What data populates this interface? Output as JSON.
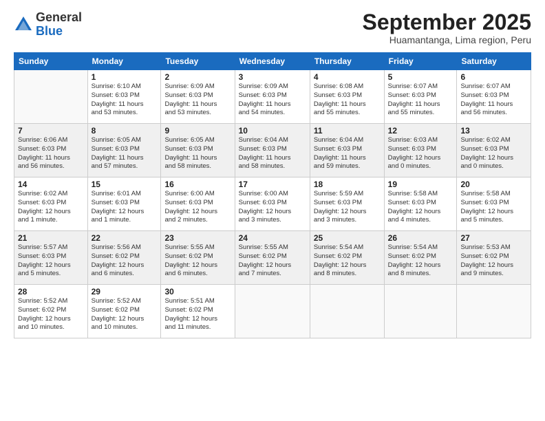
{
  "logo": {
    "general": "General",
    "blue": "Blue"
  },
  "title": "September 2025",
  "subtitle": "Huamantanga, Lima region, Peru",
  "days_of_week": [
    "Sunday",
    "Monday",
    "Tuesday",
    "Wednesday",
    "Thursday",
    "Friday",
    "Saturday"
  ],
  "weeks": [
    [
      {
        "day": "",
        "info": ""
      },
      {
        "day": "1",
        "info": "Sunrise: 6:10 AM\nSunset: 6:03 PM\nDaylight: 11 hours\nand 53 minutes."
      },
      {
        "day": "2",
        "info": "Sunrise: 6:09 AM\nSunset: 6:03 PM\nDaylight: 11 hours\nand 53 minutes."
      },
      {
        "day": "3",
        "info": "Sunrise: 6:09 AM\nSunset: 6:03 PM\nDaylight: 11 hours\nand 54 minutes."
      },
      {
        "day": "4",
        "info": "Sunrise: 6:08 AM\nSunset: 6:03 PM\nDaylight: 11 hours\nand 55 minutes."
      },
      {
        "day": "5",
        "info": "Sunrise: 6:07 AM\nSunset: 6:03 PM\nDaylight: 11 hours\nand 55 minutes."
      },
      {
        "day": "6",
        "info": "Sunrise: 6:07 AM\nSunset: 6:03 PM\nDaylight: 11 hours\nand 56 minutes."
      }
    ],
    [
      {
        "day": "7",
        "info": "Sunrise: 6:06 AM\nSunset: 6:03 PM\nDaylight: 11 hours\nand 56 minutes."
      },
      {
        "day": "8",
        "info": "Sunrise: 6:05 AM\nSunset: 6:03 PM\nDaylight: 11 hours\nand 57 minutes."
      },
      {
        "day": "9",
        "info": "Sunrise: 6:05 AM\nSunset: 6:03 PM\nDaylight: 11 hours\nand 58 minutes."
      },
      {
        "day": "10",
        "info": "Sunrise: 6:04 AM\nSunset: 6:03 PM\nDaylight: 11 hours\nand 58 minutes."
      },
      {
        "day": "11",
        "info": "Sunrise: 6:04 AM\nSunset: 6:03 PM\nDaylight: 11 hours\nand 59 minutes."
      },
      {
        "day": "12",
        "info": "Sunrise: 6:03 AM\nSunset: 6:03 PM\nDaylight: 12 hours\nand 0 minutes."
      },
      {
        "day": "13",
        "info": "Sunrise: 6:02 AM\nSunset: 6:03 PM\nDaylight: 12 hours\nand 0 minutes."
      }
    ],
    [
      {
        "day": "14",
        "info": "Sunrise: 6:02 AM\nSunset: 6:03 PM\nDaylight: 12 hours\nand 1 minute."
      },
      {
        "day": "15",
        "info": "Sunrise: 6:01 AM\nSunset: 6:03 PM\nDaylight: 12 hours\nand 1 minute."
      },
      {
        "day": "16",
        "info": "Sunrise: 6:00 AM\nSunset: 6:03 PM\nDaylight: 12 hours\nand 2 minutes."
      },
      {
        "day": "17",
        "info": "Sunrise: 6:00 AM\nSunset: 6:03 PM\nDaylight: 12 hours\nand 3 minutes."
      },
      {
        "day": "18",
        "info": "Sunrise: 5:59 AM\nSunset: 6:03 PM\nDaylight: 12 hours\nand 3 minutes."
      },
      {
        "day": "19",
        "info": "Sunrise: 5:58 AM\nSunset: 6:03 PM\nDaylight: 12 hours\nand 4 minutes."
      },
      {
        "day": "20",
        "info": "Sunrise: 5:58 AM\nSunset: 6:03 PM\nDaylight: 12 hours\nand 5 minutes."
      }
    ],
    [
      {
        "day": "21",
        "info": "Sunrise: 5:57 AM\nSunset: 6:03 PM\nDaylight: 12 hours\nand 5 minutes."
      },
      {
        "day": "22",
        "info": "Sunrise: 5:56 AM\nSunset: 6:02 PM\nDaylight: 12 hours\nand 6 minutes."
      },
      {
        "day": "23",
        "info": "Sunrise: 5:55 AM\nSunset: 6:02 PM\nDaylight: 12 hours\nand 6 minutes."
      },
      {
        "day": "24",
        "info": "Sunrise: 5:55 AM\nSunset: 6:02 PM\nDaylight: 12 hours\nand 7 minutes."
      },
      {
        "day": "25",
        "info": "Sunrise: 5:54 AM\nSunset: 6:02 PM\nDaylight: 12 hours\nand 8 minutes."
      },
      {
        "day": "26",
        "info": "Sunrise: 5:54 AM\nSunset: 6:02 PM\nDaylight: 12 hours\nand 8 minutes."
      },
      {
        "day": "27",
        "info": "Sunrise: 5:53 AM\nSunset: 6:02 PM\nDaylight: 12 hours\nand 9 minutes."
      }
    ],
    [
      {
        "day": "28",
        "info": "Sunrise: 5:52 AM\nSunset: 6:02 PM\nDaylight: 12 hours\nand 10 minutes."
      },
      {
        "day": "29",
        "info": "Sunrise: 5:52 AM\nSunset: 6:02 PM\nDaylight: 12 hours\nand 10 minutes."
      },
      {
        "day": "30",
        "info": "Sunrise: 5:51 AM\nSunset: 6:02 PM\nDaylight: 12 hours\nand 11 minutes."
      },
      {
        "day": "",
        "info": ""
      },
      {
        "day": "",
        "info": ""
      },
      {
        "day": "",
        "info": ""
      },
      {
        "day": "",
        "info": ""
      }
    ]
  ]
}
